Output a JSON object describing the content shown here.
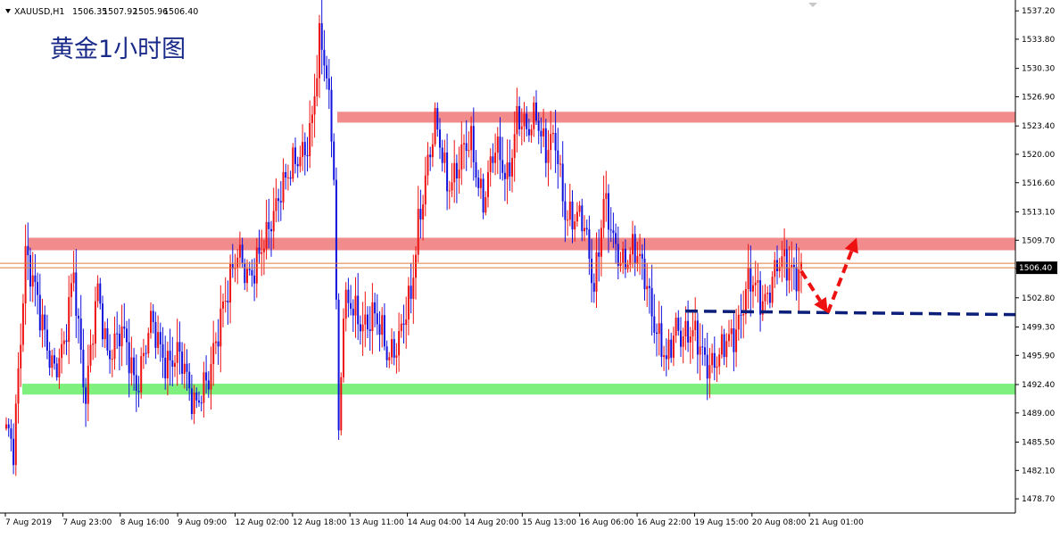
{
  "chart_data": {
    "type": "candlestick",
    "symbol_line": {
      "symbol": "XAUUSD,H1",
      "open": "1506.35",
      "high": "1507.92",
      "low": "1505.96",
      "close": "1506.40"
    },
    "title": "黄金1小时图",
    "current_price": 1506.4,
    "current_price_label": "1506.40",
    "ylim": [
      1477.0,
      1538.5
    ],
    "y_ticks": [
      "1537.20",
      "1533.80",
      "1530.30",
      "1526.90",
      "1523.40",
      "1520.00",
      "1516.60",
      "1513.10",
      "1509.70",
      "1506.30",
      "1502.80",
      "1499.30",
      "1495.90",
      "1492.40",
      "1489.00",
      "1485.50",
      "1482.10",
      "1478.70"
    ],
    "x_labels": [
      "7 Aug 2019",
      "7 Aug 23:00",
      "8 Aug 16:00",
      "9 Aug 09:00",
      "12 Aug 02:00",
      "12 Aug 18:00",
      "13 Aug 11:00",
      "14 Aug 04:00",
      "14 Aug 20:00",
      "15 Aug 13:00",
      "16 Aug 06:00",
      "16 Aug 22:00",
      "19 Aug 15:00",
      "20 Aug 08:00",
      "21 Aug 01:00"
    ],
    "zones": [
      {
        "name": "resistance-high",
        "low": 1523.8,
        "high": 1525.1,
        "color": "#f28b8b"
      },
      {
        "name": "resistance-mid",
        "low": 1508.5,
        "high": 1510.0,
        "color": "#f28b8b"
      },
      {
        "name": "support",
        "low": 1491.2,
        "high": 1492.5,
        "color": "#7ef07e"
      }
    ],
    "up_color": "#ee1111",
    "down_color": "#1111dd",
    "key_path": [
      [
        0,
        1486
      ],
      [
        3,
        1484
      ],
      [
        8,
        1509
      ],
      [
        14,
        1500
      ],
      [
        20,
        1495
      ],
      [
        24,
        1496
      ],
      [
        28,
        1506
      ],
      [
        33,
        1491
      ],
      [
        38,
        1503
      ],
      [
        42,
        1497
      ],
      [
        48,
        1498
      ],
      [
        54,
        1493
      ],
      [
        60,
        1499
      ],
      [
        66,
        1496
      ],
      [
        72,
        1495
      ],
      [
        78,
        1491
      ],
      [
        84,
        1492
      ],
      [
        90,
        1503
      ],
      [
        96,
        1507
      ],
      [
        100,
        1506
      ],
      [
        108,
        1509
      ],
      [
        114,
        1517
      ],
      [
        120,
        1518
      ],
      [
        124,
        1521
      ],
      [
        127,
        1525
      ],
      [
        130,
        1533
      ],
      [
        133,
        1529
      ],
      [
        136,
        1519
      ],
      [
        138,
        1487
      ],
      [
        140,
        1502
      ],
      [
        146,
        1500
      ],
      [
        152,
        1501
      ],
      [
        158,
        1496
      ],
      [
        164,
        1499
      ],
      [
        168,
        1502
      ],
      [
        171,
        1512
      ],
      [
        174,
        1518
      ],
      [
        178,
        1523
      ],
      [
        183,
        1517
      ],
      [
        188,
        1519
      ],
      [
        193,
        1521
      ],
      [
        198,
        1515
      ],
      [
        203,
        1520
      ],
      [
        208,
        1518
      ],
      [
        212,
        1524
      ],
      [
        216,
        1522
      ],
      [
        220,
        1526
      ],
      [
        224,
        1520
      ],
      [
        228,
        1521
      ],
      [
        232,
        1514
      ],
      [
        236,
        1512
      ],
      [
        240,
        1511
      ],
      [
        244,
        1505
      ],
      [
        248,
        1514
      ],
      [
        252,
        1509
      ],
      [
        256,
        1508
      ],
      [
        260,
        1508
      ],
      [
        266,
        1505
      ],
      [
        270,
        1499
      ],
      [
        274,
        1494
      ],
      [
        278,
        1500
      ],
      [
        284,
        1498
      ],
      [
        290,
        1496
      ],
      [
        296,
        1495
      ],
      [
        302,
        1499
      ],
      [
        308,
        1504
      ],
      [
        314,
        1503
      ],
      [
        320,
        1506
      ],
      [
        326,
        1507
      ],
      [
        330,
        1506
      ]
    ],
    "forecast": {
      "color": "#ee1111",
      "points": [
        [
          330,
          1506
        ],
        [
          341,
          1501
        ],
        [
          353,
          1510
        ]
      ]
    },
    "level_line": {
      "value": 1501,
      "color": "#0b1f7a"
    }
  }
}
